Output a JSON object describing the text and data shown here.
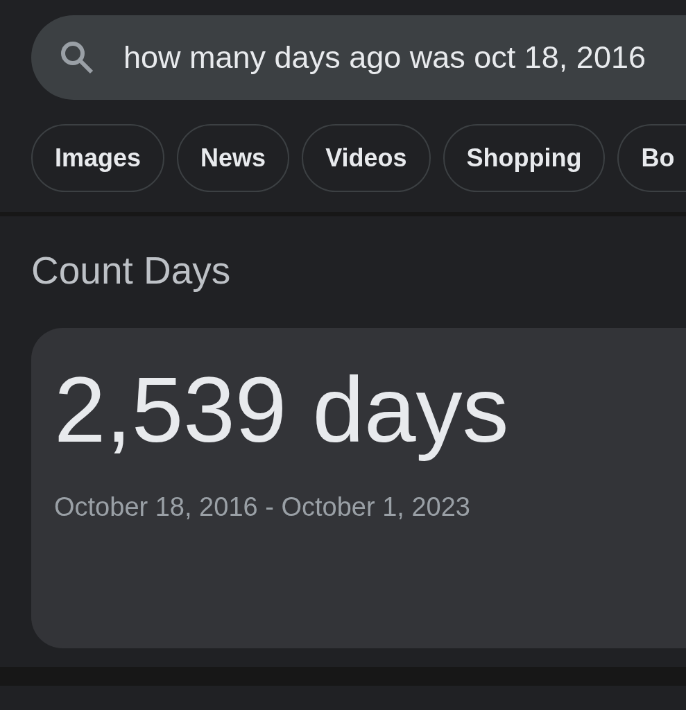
{
  "search": {
    "query": "how many days ago was oct 18, 2016"
  },
  "filter_chips": [
    {
      "label": "Images"
    },
    {
      "label": "News"
    },
    {
      "label": "Videos"
    },
    {
      "label": "Shopping"
    },
    {
      "label": "Bo"
    }
  ],
  "result": {
    "title": "Count Days",
    "value": "2,539 days",
    "date_range": "October 18, 2016 - October 1, 2023"
  }
}
